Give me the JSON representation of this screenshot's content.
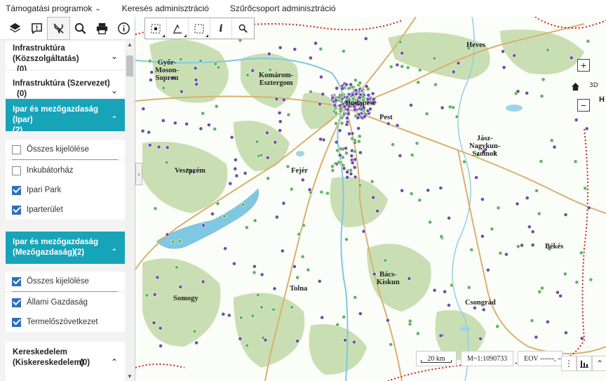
{
  "top_menu": {
    "items": [
      {
        "label": "Támogatási programok",
        "has_dropdown": true
      },
      {
        "label": "Keresés adminisztráció"
      },
      {
        "label": "Szűrőcsoport adminisztráció"
      }
    ]
  },
  "sidebar": {
    "toolbar_icons": [
      "layers-icon",
      "comment-icon",
      "filter-off-icon",
      "search-icon",
      "print-icon",
      "info-icon"
    ],
    "sections": [
      {
        "label": "Infrastruktúra (Közszolgáltatás)",
        "count": "(0)",
        "expanded": false
      },
      {
        "label": "Infrastruktúra (Szervezet)",
        "count": "(0)",
        "expanded": false
      },
      {
        "label": "Ipar és mezőgazdaság (Ipar)",
        "count": "(2)",
        "expanded": true,
        "items": [
          {
            "label": "Összes kijelölése",
            "checked": false
          },
          {
            "label": "Inkubátorház",
            "checked": false
          },
          {
            "label": "Ipari Park",
            "checked": true
          },
          {
            "label": "Iparterület",
            "checked": true
          }
        ]
      },
      {
        "label": "Ipar és mezőgazdaság (Mezőgazdaság)",
        "count": "(2)",
        "expanded": true,
        "items": [
          {
            "label": "Összes kijelölése",
            "checked": true
          },
          {
            "label": "Állami Gazdaság",
            "checked": true
          },
          {
            "label": "Termelőszövetkezet",
            "checked": true
          }
        ]
      },
      {
        "label": "Kereskedelem (Kiskereskedelem)",
        "count": "(0)",
        "expanded": false
      }
    ]
  },
  "map": {
    "tools": [
      "box-select-icon",
      "measure-icon",
      "area-select-icon",
      "i",
      "zoom-search-icon"
    ],
    "places": [
      {
        "name": "Győr-\nMoson-\nSopron"
      },
      {
        "name": "Komárom-\nEsztergom"
      },
      {
        "name": "Heves"
      },
      {
        "name": "Budapest"
      },
      {
        "name": "Pest"
      },
      {
        "name": "Veszprém"
      },
      {
        "name": "Fejér"
      },
      {
        "name": "Jász-\nNagykun-\nSzolnok"
      },
      {
        "name": "Békés"
      },
      {
        "name": "Bács-\nKiskun"
      },
      {
        "name": "Tolna"
      },
      {
        "name": "Somogy"
      },
      {
        "name": "Csongrád"
      }
    ],
    "zoom_in": "+",
    "zoom_out": "−",
    "view_3d": "3D",
    "edge_letter": "H",
    "status": {
      "scale_label": "20 km",
      "ratio": "M~1:1090733",
      "coords": "EOV ------, ------"
    },
    "colors": {
      "water": "#7ec8e3",
      "forest": "#c9dfb3",
      "road": "#d9b06f",
      "border": "#cc2222",
      "marker_purple": "#6f4fa8",
      "marker_green": "#5cb85c"
    }
  }
}
